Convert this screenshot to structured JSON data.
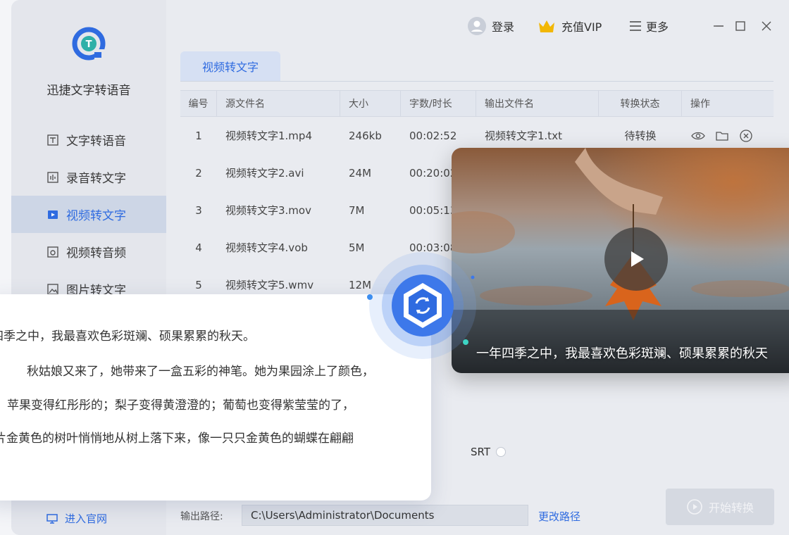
{
  "app": {
    "name": "迅捷文字转语音"
  },
  "topbar": {
    "login": "登录",
    "vip": "充值VIP",
    "more": "更多"
  },
  "sidebar": {
    "items": [
      {
        "label": "文字转语音",
        "icon": "text-to-speech-icon"
      },
      {
        "label": "录音转文字",
        "icon": "audio-to-text-icon"
      },
      {
        "label": "视频转文字",
        "icon": "video-to-text-icon",
        "active": true
      },
      {
        "label": "视频转音频",
        "icon": "video-to-audio-icon"
      },
      {
        "label": "图片转文字",
        "icon": "image-to-text-icon"
      }
    ],
    "official": "进入官网"
  },
  "tab": {
    "label": "视频转文字"
  },
  "table": {
    "headers": [
      "编号",
      "源文件名",
      "大小",
      "字数/时长",
      "输出文件名",
      "转换状态",
      "操作"
    ],
    "rows": [
      {
        "no": "1",
        "name": "视频转文字1.mp4",
        "size": "246kb",
        "duration": "00:02:52",
        "output": "视频转文字1.txt",
        "status": "待转换"
      },
      {
        "no": "2",
        "name": "视频转文字2.avi",
        "size": "24M",
        "duration": "00:20:02"
      },
      {
        "no": "3",
        "name": "视频转文字3.mov",
        "size": "7M",
        "duration": "00:05:13"
      },
      {
        "no": "4",
        "name": "视频转文字4.vob",
        "size": "5M",
        "duration": "00:03:08"
      },
      {
        "no": "5",
        "name": "视频转文字5.wmv",
        "size": "12M"
      }
    ]
  },
  "format": {
    "srt": "SRT"
  },
  "output": {
    "label": "输出路径:",
    "path": "C:\\Users\\Administrator\\Documents",
    "change": "更改路径"
  },
  "start_button": "开始转换",
  "text_card": {
    "lines": [
      "四季之中，我最喜欢色彩斑斓、硕果累累的秋天。",
      "秋姑娘又来了，她带来了一盒五彩的神笔。她为果园涂上了颜色，",
      "苹果变得红彤彤的；梨子变得黄澄澄的；葡萄也变得紫莹莹的了，",
      "片金黄色的树叶悄悄地从树上落下来，像一只只金黄色的蝴蝶在翩翩"
    ]
  },
  "video_card": {
    "subtitle": "一年四季之中，我最喜欢色彩斑斓、硕果累累的秋天"
  },
  "colors": {
    "accent": "#2f6be0",
    "active_bg": "#cdd6e6",
    "vip": "#f2b705"
  }
}
